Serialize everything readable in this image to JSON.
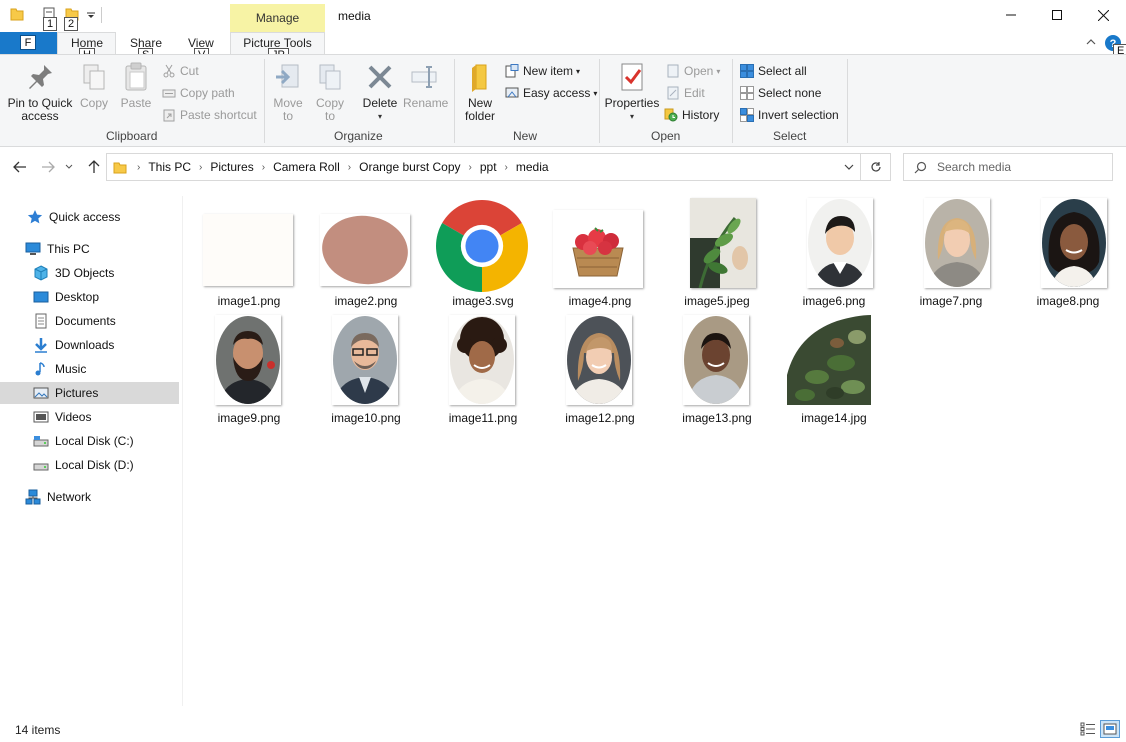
{
  "window": {
    "contextual_tab": "Manage",
    "title": "media",
    "key_tips": [
      "1",
      "2"
    ]
  },
  "tabs": {
    "file_key": "F",
    "home": "Home",
    "home_key": "H",
    "share": "Share",
    "share_key": "S",
    "view": "View",
    "view_key": "V",
    "picture_tools": "Picture Tools",
    "picture_tools_key": "JP",
    "help_key": "E"
  },
  "ribbon": {
    "clipboard": {
      "label": "Clipboard",
      "pin": "Pin to Quick\naccess",
      "copy": "Copy",
      "paste": "Paste",
      "cut": "Cut",
      "copy_path": "Copy path",
      "paste_shortcut": "Paste shortcut"
    },
    "organize": {
      "label": "Organize",
      "move_to": "Move\nto",
      "copy_to": "Copy\nto",
      "delete": "Delete",
      "rename": "Rename"
    },
    "new": {
      "label": "New",
      "new_folder": "New\nfolder",
      "new_item": "New item",
      "easy_access": "Easy access"
    },
    "open": {
      "label": "Open",
      "properties": "Properties",
      "open": "Open",
      "edit": "Edit",
      "history": "History"
    },
    "select": {
      "label": "Select",
      "select_all": "Select all",
      "select_none": "Select none",
      "invert_selection": "Invert selection"
    }
  },
  "address": {
    "crumbs": [
      "This PC",
      "Pictures",
      "Camera Roll",
      "Orange burst Copy",
      "ppt",
      "media"
    ],
    "search_placeholder": "Search media"
  },
  "sidebar": {
    "items": [
      {
        "label": "Quick access",
        "icon": "star-icon"
      },
      {
        "label": "This PC",
        "icon": "computer-icon"
      },
      {
        "label": "3D Objects",
        "icon": "cube-icon"
      },
      {
        "label": "Desktop",
        "icon": "desktop-icon"
      },
      {
        "label": "Documents",
        "icon": "document-icon"
      },
      {
        "label": "Downloads",
        "icon": "download-icon"
      },
      {
        "label": "Music",
        "icon": "music-icon"
      },
      {
        "label": "Pictures",
        "icon": "pictures-icon"
      },
      {
        "label": "Videos",
        "icon": "video-icon"
      },
      {
        "label": "Local Disk (C:)",
        "icon": "drive-icon"
      },
      {
        "label": "Local Disk (D:)",
        "icon": "drive-icon"
      },
      {
        "label": "Network",
        "icon": "network-icon"
      }
    ],
    "selected": "Pictures"
  },
  "files": [
    {
      "name": "image1.png"
    },
    {
      "name": "image2.png"
    },
    {
      "name": "image3.svg"
    },
    {
      "name": "image4.png"
    },
    {
      "name": "image5.jpeg"
    },
    {
      "name": "image6.png"
    },
    {
      "name": "image7.png"
    },
    {
      "name": "image8.png"
    },
    {
      "name": "image9.png"
    },
    {
      "name": "image10.png"
    },
    {
      "name": "image11.png"
    },
    {
      "name": "image12.png"
    },
    {
      "name": "image13.png"
    },
    {
      "name": "image14.jpg"
    }
  ],
  "status": {
    "count": "14 items"
  },
  "colors": {
    "file_tab": "#1979ca",
    "manage_tab": "#f7f3a5",
    "selection": "#d9d9d9"
  }
}
